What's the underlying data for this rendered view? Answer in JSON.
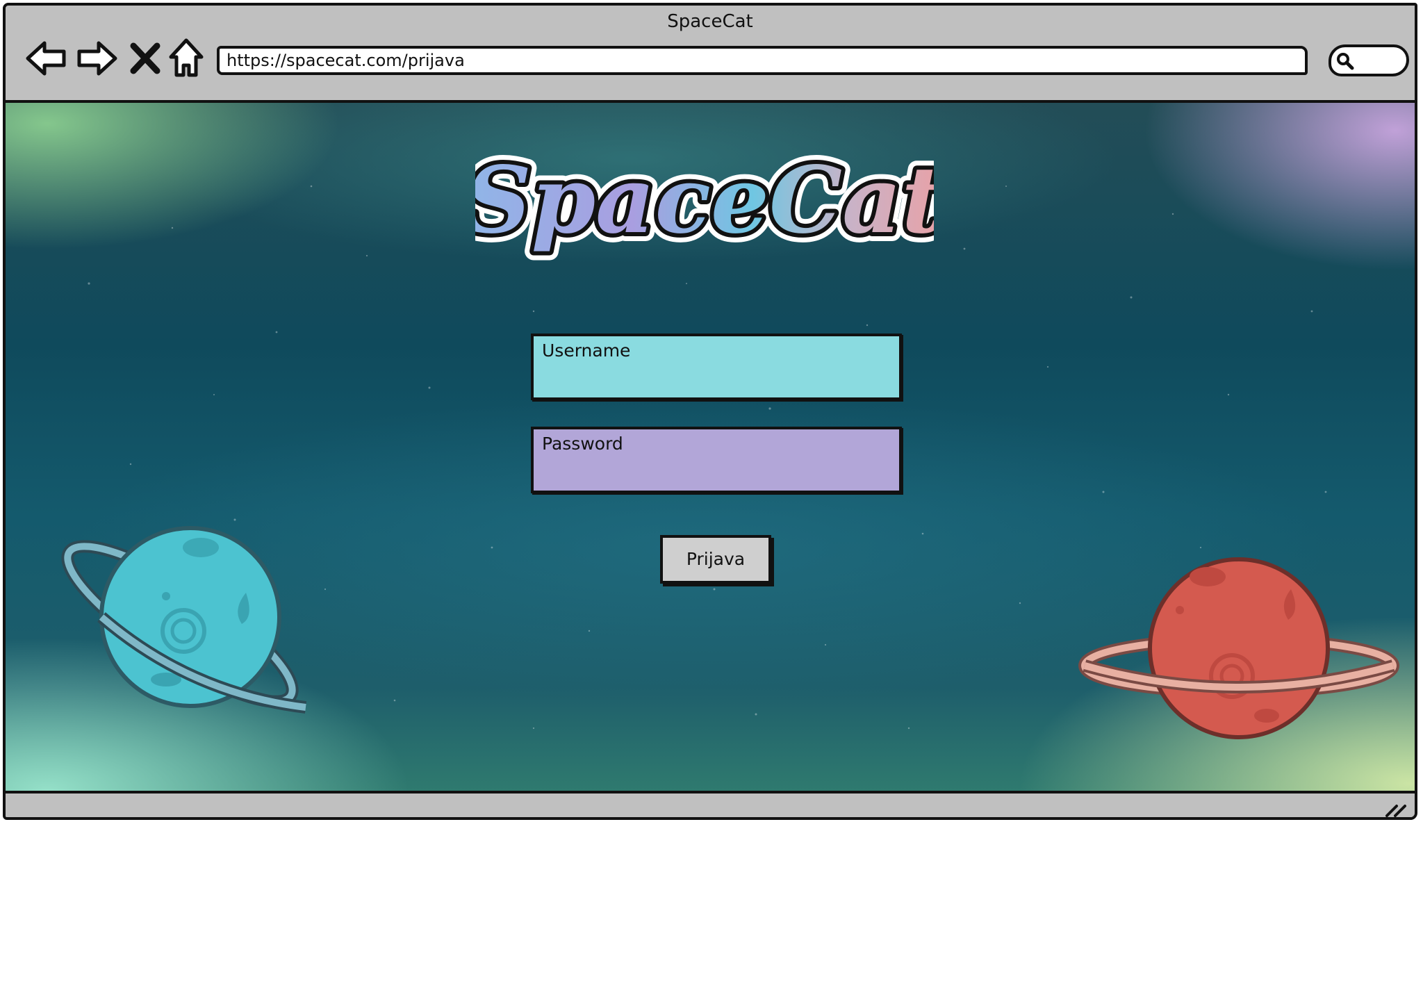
{
  "window": {
    "title": "SpaceCat"
  },
  "toolbar": {
    "back": "back-arrow-icon",
    "forward": "forward-arrow-icon",
    "stop": "close-icon",
    "home": "home-icon",
    "url": "https://spacecat.com/prijava",
    "search": "search-icon"
  },
  "page": {
    "logo_text": "SpaceCat",
    "username_placeholder": "Username",
    "password_placeholder": "Password",
    "login_label": "Prijava"
  },
  "colors": {
    "chrome": "#c0c0c0",
    "username_field": "#8adbe0",
    "password_field": "#b2a6d8",
    "button": "#cfcfcf",
    "planet_blue": "#4cc3d0",
    "planet_red": "#d45a4f"
  }
}
